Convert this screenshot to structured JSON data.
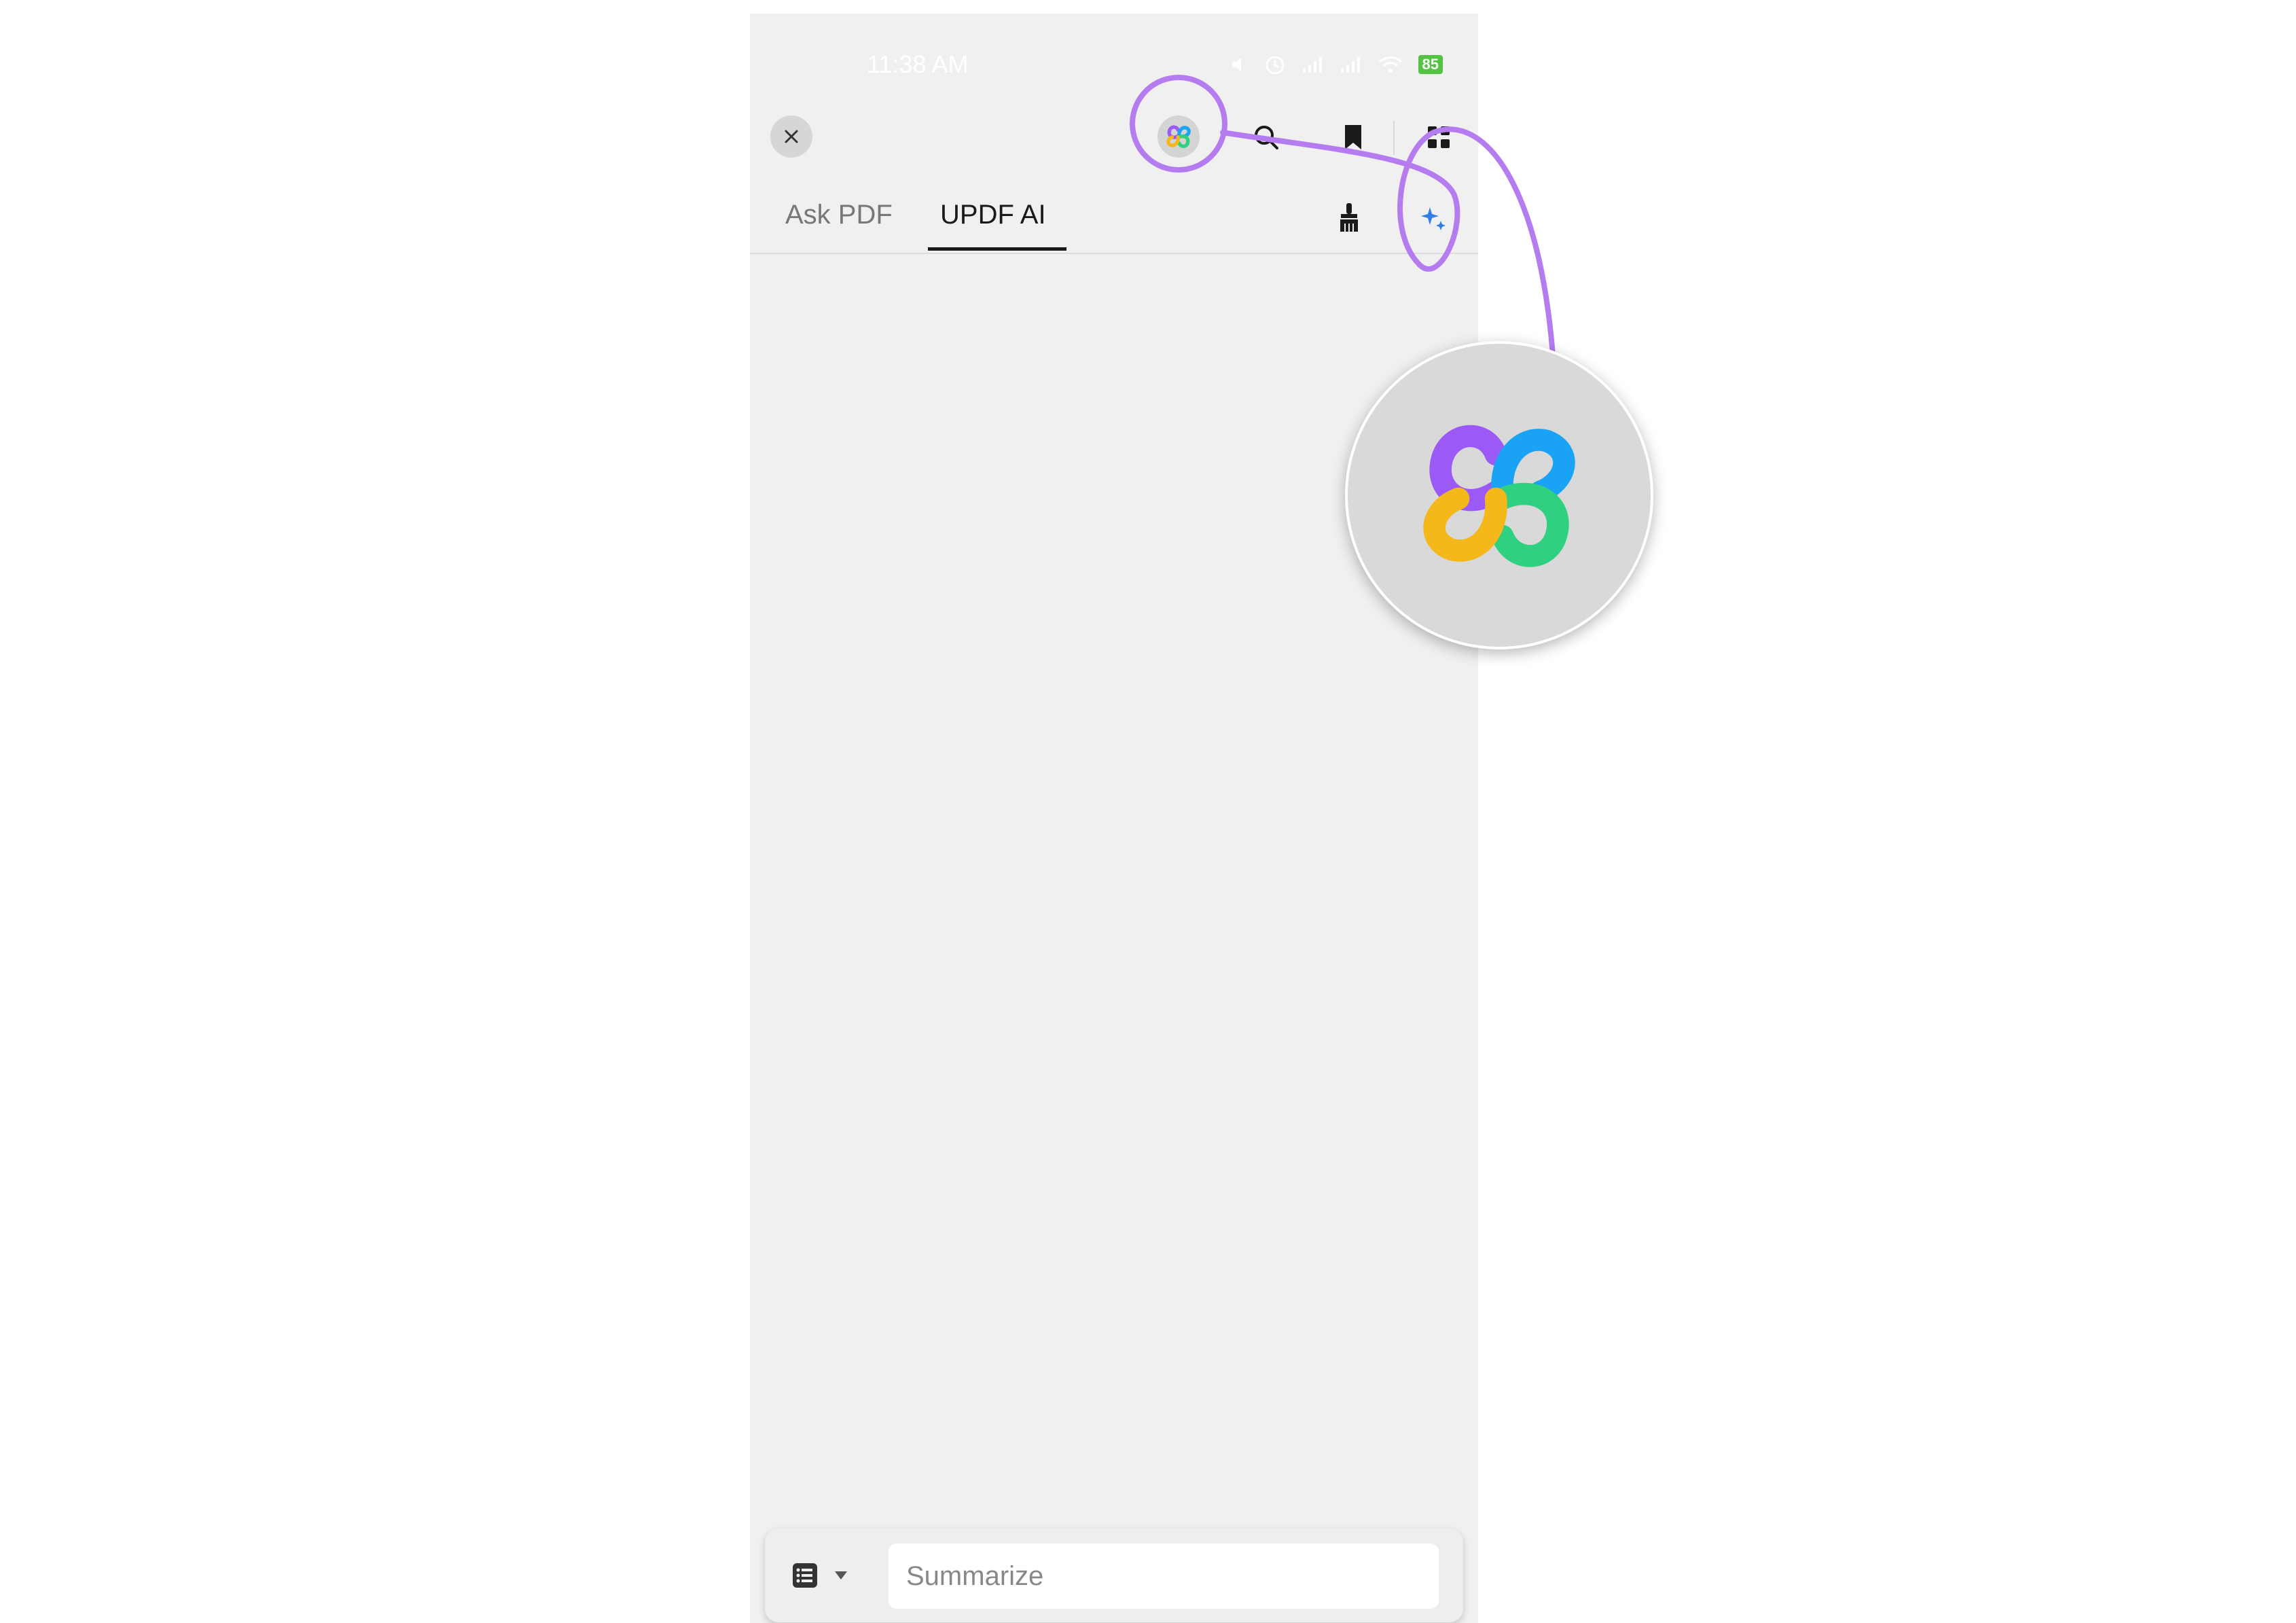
{
  "status_bar": {
    "time": "11:38 AM",
    "battery": "85",
    "icons": [
      "mute-icon",
      "alarm-icon",
      "signal-icon",
      "signal-icon",
      "wifi-icon",
      "battery-icon"
    ]
  },
  "toolbar": {
    "icons": [
      "close-icon",
      "updf-ai-logo-icon",
      "search-icon",
      "bookmark-icon",
      "grid-icon"
    ]
  },
  "tabs": [
    {
      "label": "Ask PDF",
      "active": false
    },
    {
      "label": "UPDF AI",
      "active": true
    }
  ],
  "tab_actions": [
    "broom-icon",
    "sparkle-icon"
  ],
  "input_bar": {
    "placeholder": "Summarize",
    "value": "",
    "prompt_type_icons": [
      "list-icon",
      "dropdown-arrow-icon"
    ]
  },
  "annotation": {
    "zoomed_icon": "updf-ai-logo-icon",
    "accent_color": "#b57cf0"
  },
  "colors": {
    "panel_background": "#f0f0f0",
    "annotation": "#b57cf0",
    "logo": [
      "#9b59f5",
      "#1aa3f5",
      "#2fd07f",
      "#f5b81a"
    ]
  }
}
